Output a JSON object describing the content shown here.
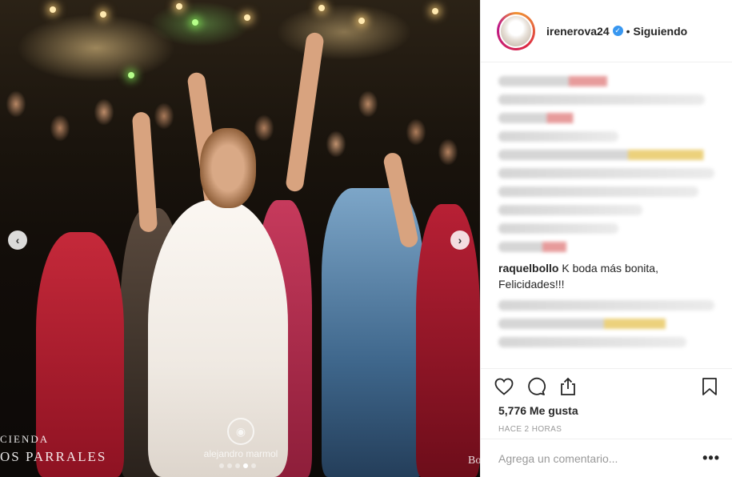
{
  "post": {
    "username": "irenerova24",
    "verified": true,
    "separator": "•",
    "follow_status": "Siguiendo"
  },
  "photo": {
    "watermark_left_line1": "CIENDA",
    "watermark_left_line2": "OS PARRALES",
    "watermark_center": "alejandro marmol",
    "watermark_right": "Bo",
    "carousel_prev": "‹",
    "carousel_next": "›"
  },
  "comments": {
    "visible": [
      {
        "username": "raquelbollo",
        "text": "K boda más bonita, Felicidades!!!"
      }
    ]
  },
  "actions": {
    "likes": "5,776 Me gusta",
    "timestamp": "HACE 2 HORAS",
    "add_comment_placeholder": "Agrega un comentario...",
    "more_label": "•••"
  },
  "colors": {
    "accent_blue": "#3897f0",
    "text_primary": "#262626",
    "text_secondary": "#999999"
  }
}
